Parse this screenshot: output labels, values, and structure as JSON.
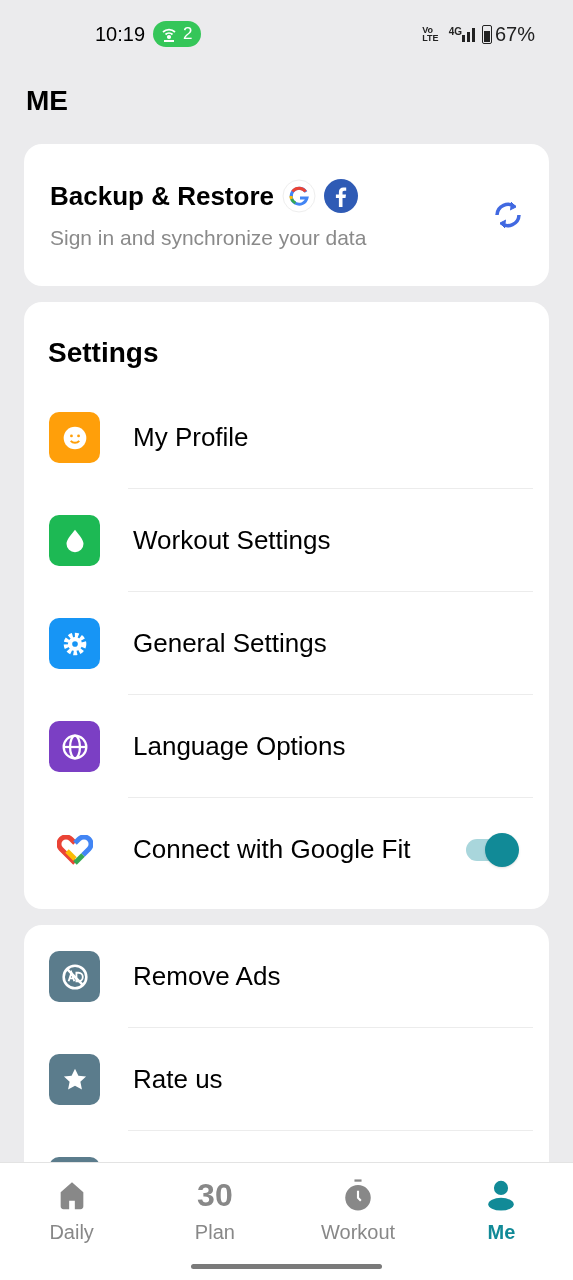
{
  "status_bar": {
    "time": "10:19",
    "hotspot_count": "2",
    "volte": [
      "Vo",
      "LTE"
    ],
    "network": "4G",
    "battery": "67%"
  },
  "title": "ME",
  "backup": {
    "title": "Backup & Restore",
    "subtitle": "Sign in and synchronize your data"
  },
  "settings": {
    "heading": "Settings",
    "items": [
      {
        "kind": "link",
        "color": "#ff9f0a",
        "label": "My Profile"
      },
      {
        "kind": "link",
        "color": "#1db954",
        "label": "Workout Settings"
      },
      {
        "kind": "link",
        "color": "#1795f5",
        "label": "General Settings"
      },
      {
        "kind": "link",
        "color": "#7b3fc4",
        "label": "Language Options"
      },
      {
        "kind": "toggle",
        "label": "Connect with Google Fit",
        "on": true
      }
    ]
  },
  "more": {
    "items": [
      {
        "color": "#5b7c8c",
        "label": "Remove Ads"
      },
      {
        "color": "#5b7c8c",
        "label": "Rate us"
      },
      {
        "color": "#5b7c8c"
      }
    ]
  },
  "tabs": [
    {
      "label": "Daily",
      "selected": false
    },
    {
      "label": "Plan",
      "icon_text": "30",
      "selected": false
    },
    {
      "label": "Workout",
      "selected": false
    },
    {
      "label": "Me",
      "selected": true
    }
  ]
}
